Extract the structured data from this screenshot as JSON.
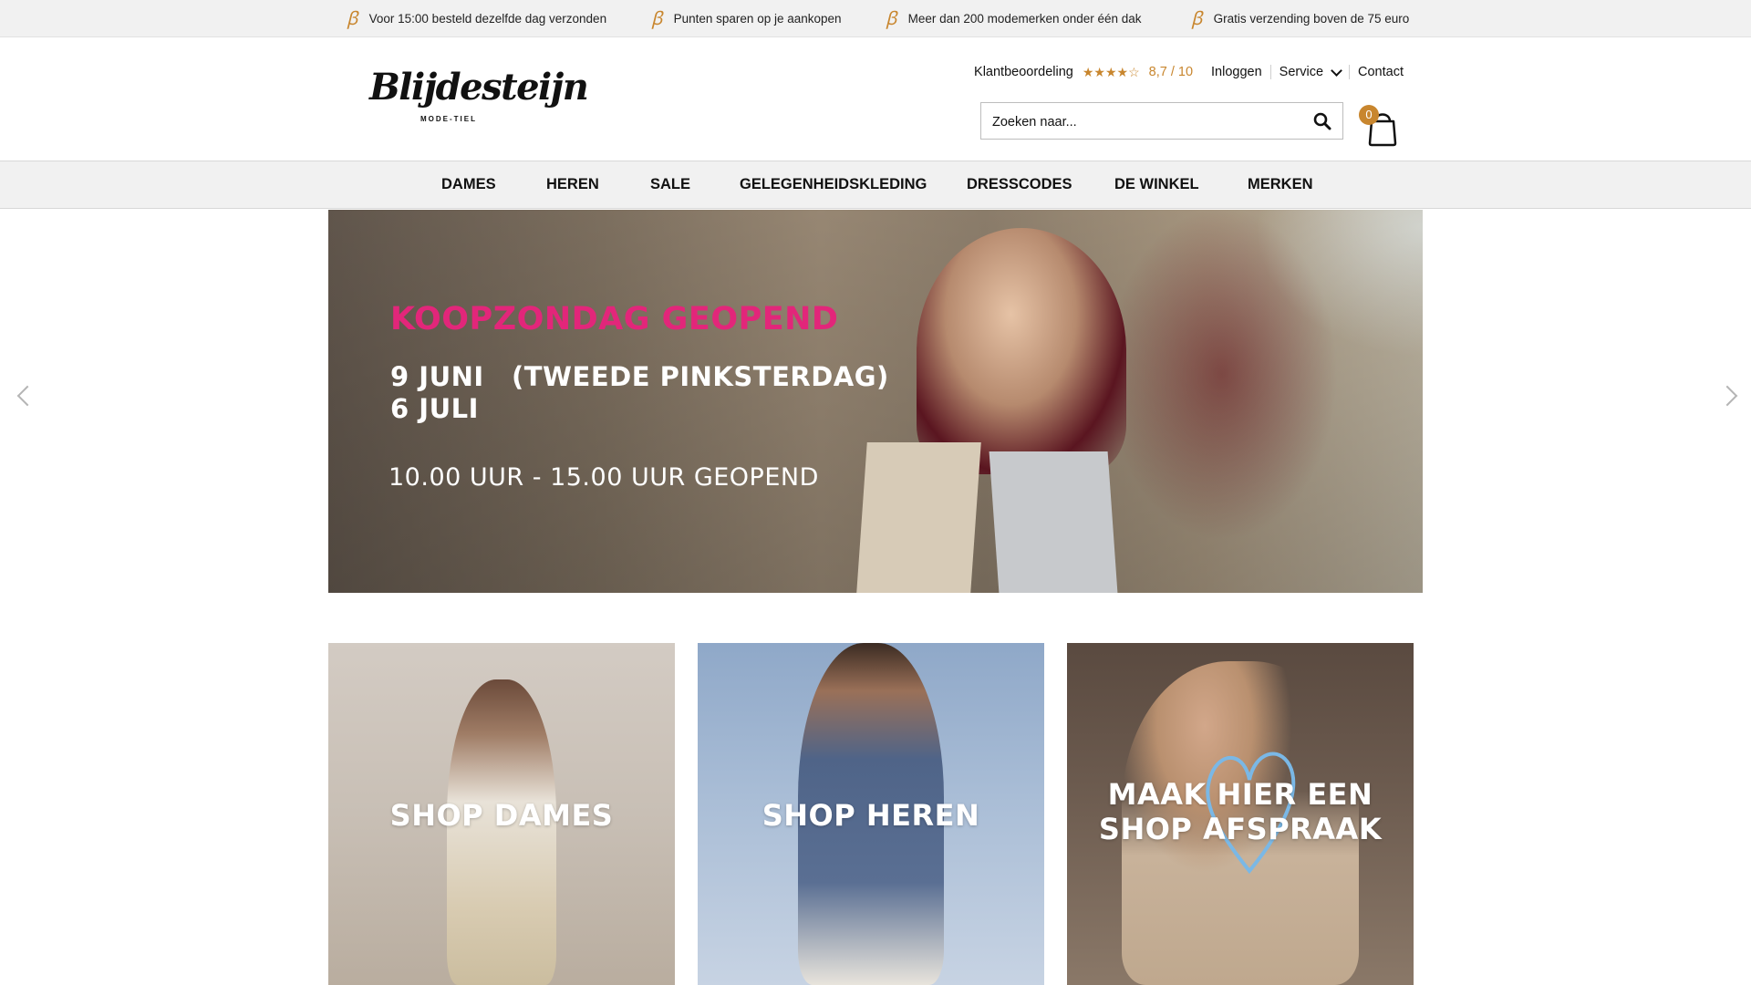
{
  "usp": [
    {
      "icon": "b-logo-icon",
      "text": "Voor 15:00 besteld dezelfde dag verzonden"
    },
    {
      "icon": "b-logo-icon",
      "text": "Punten sparen op je aankopen"
    },
    {
      "icon": "b-logo-icon",
      "text": "Meer dan 200 modemerken onder één dak"
    },
    {
      "icon": "b-logo-icon",
      "text": "Gratis verzending boven de 75 euro"
    }
  ],
  "brand": {
    "name": "Blijdesteijn",
    "subtitle": "MODE-TIEL"
  },
  "top_links": {
    "rating_label": "Klantbeoordeling",
    "rating_stars": 4.5,
    "rating_value": "8,7 / 10",
    "login": "Inloggen",
    "service": "Service",
    "contact": "Contact"
  },
  "search": {
    "placeholder": "Zoeken naar..."
  },
  "cart": {
    "count": "0"
  },
  "nav": [
    "DAMES",
    "HEREN",
    "SALE",
    "GELEGENHEIDSKLEDING",
    "DRESSCODES",
    "DE WINKEL",
    "MERKEN"
  ],
  "hero": {
    "title": "KOOPZONDAG GEOPEND",
    "date1": "9 JUNI",
    "note1": "(TWEEDE PINKSTERDAG)",
    "date2": "6 JULI",
    "hours": "10.00 UUR - 15.00 UUR GEOPEND"
  },
  "tiles": [
    {
      "label": "SHOP DAMES"
    },
    {
      "label": "SHOP HEREN"
    },
    {
      "label_line1": "MAAK HIER EEN",
      "label_line2": "SHOP AFSPRAAK"
    }
  ],
  "colors": {
    "accent": "#c8862e",
    "hero_title": "#e2267a",
    "nav_bg": "#f1f1f1"
  }
}
